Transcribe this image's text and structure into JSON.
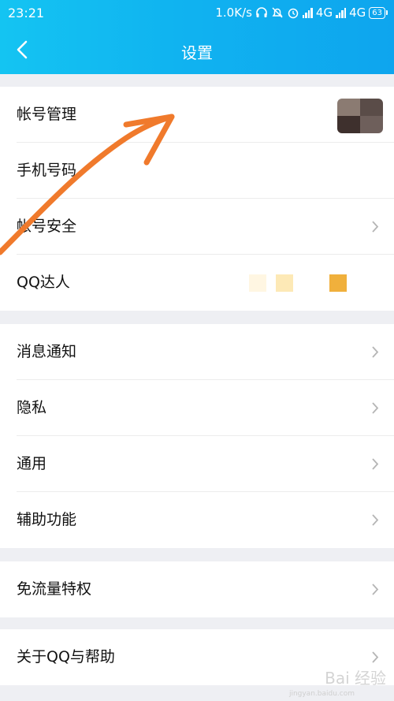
{
  "status_bar": {
    "time": "23:21",
    "speed": "1.0K/s",
    "net1": "4G",
    "net2": "4G",
    "battery": "63",
    "icons": [
      "headphones-icon",
      "mute-icon",
      "alarm-icon",
      "signal-icon"
    ]
  },
  "header": {
    "title": "设置",
    "back_icon": "chevron-left-icon",
    "color": "#10b3f0"
  },
  "groups": [
    {
      "items": [
        {
          "label": "帐号管理"
        },
        {
          "label": "手机号码"
        },
        {
          "label": "帐号安全"
        },
        {
          "label": "QQ达人"
        }
      ]
    },
    {
      "items": [
        {
          "label": "消息通知"
        },
        {
          "label": "隐私"
        },
        {
          "label": "通用"
        },
        {
          "label": "辅助功能"
        }
      ]
    },
    {
      "items": [
        {
          "label": "免流量特权"
        }
      ]
    },
    {
      "items": [
        {
          "label": "关于QQ与帮助"
        }
      ]
    }
  ],
  "watermark": {
    "text": "Bai 经验",
    "sub": "jingyan.baidu.com"
  },
  "annotation_color": "#f07a2c"
}
